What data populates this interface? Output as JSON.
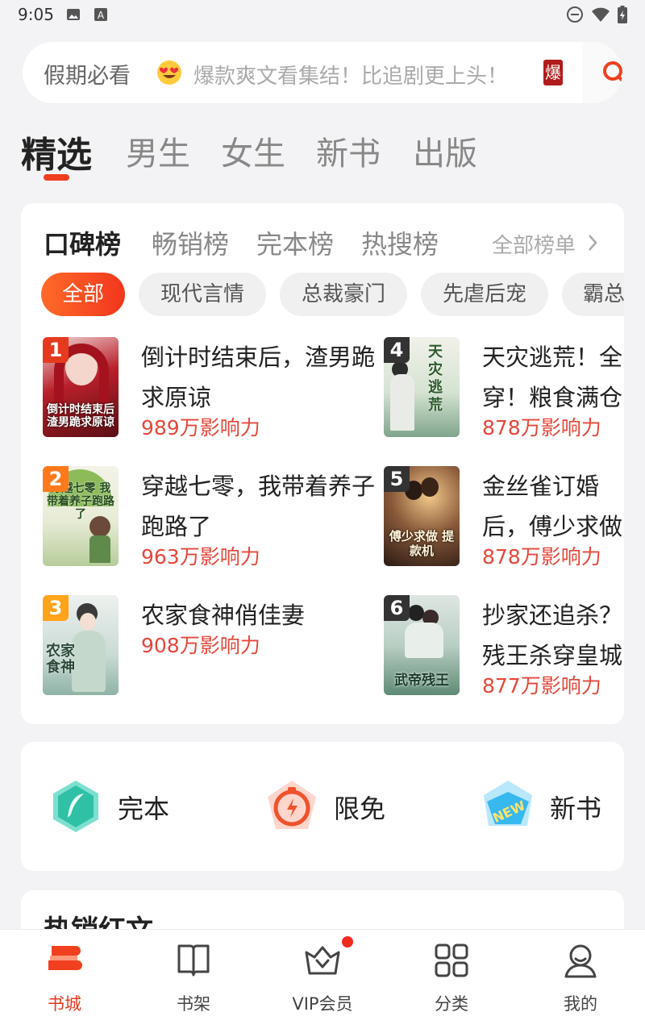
{
  "status": {
    "time": "9:05"
  },
  "search": {
    "prefix": "假期必看",
    "hint": "爆款爽文看集结！比追剧更上头！",
    "badge": "爆"
  },
  "top_tabs": [
    "精选",
    "男生",
    "女生",
    "新书",
    "出版"
  ],
  "rank_tabs": [
    "口碑榜",
    "畅销榜",
    "完本榜",
    "热搜榜"
  ],
  "all_ranks": "全部榜单",
  "chips": [
    "全部",
    "现代言情",
    "总裁豪门",
    "先虐后宠",
    "霸总"
  ],
  "books": [
    {
      "rank": "1",
      "title": "倒计时结束后，渣男跪求原谅",
      "influence": "989万影响力",
      "cover_text": "倒计时结束后 渣男跪求原谅"
    },
    {
      "rank": "2",
      "title": "穿越七零，我带着养子跑路了",
      "influence": "963万影响力",
      "cover_text": "穿越七零 我带着养子跑路了"
    },
    {
      "rank": "3",
      "title": "农家食神俏佳妻",
      "influence": "908万影响力",
      "cover_text": "农家食神"
    },
    {
      "rank": "4",
      "title": "天灾逃荒！全穿！粮食满仓",
      "influence": "878万影响力",
      "cover_text": "天灾逃荒"
    },
    {
      "rank": "5",
      "title": "金丝雀订婚后，傅少求做提款机",
      "influence": "878万影响力",
      "cover_text": "傅少求做 提款机"
    },
    {
      "rank": "6",
      "title": "抄家还追杀？残王杀穿皇城",
      "influence": "877万影响力",
      "cover_text": "武帝残王"
    }
  ],
  "quick": [
    {
      "label": "完本",
      "icon": "feather-book-icon"
    },
    {
      "label": "限免",
      "icon": "stopwatch-bolt-icon"
    },
    {
      "label": "新书",
      "icon": "new-tag-icon"
    }
  ],
  "hot_section_title": "热销红文",
  "nav": [
    {
      "label": "书城",
      "icon": "bookstore-icon"
    },
    {
      "label": "书架",
      "icon": "bookshelf-icon"
    },
    {
      "label": "VIP会员",
      "icon": "vip-crown-icon"
    },
    {
      "label": "分类",
      "icon": "category-grid-icon"
    },
    {
      "label": "我的",
      "icon": "profile-icon"
    }
  ],
  "colors": {
    "accent": "#ef3f1f",
    "influence": "#e5473a",
    "rank_red": "#e63a1e",
    "rank_orange": "#ff7a1c",
    "rank_amber": "#ffa31a",
    "rank_dark": "#333333"
  }
}
